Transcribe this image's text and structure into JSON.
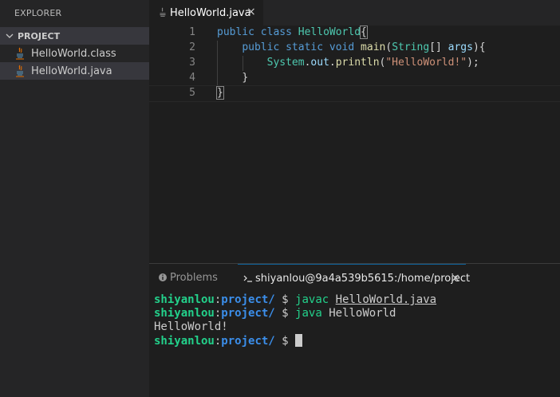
{
  "sidebar": {
    "title": "EXPLORER",
    "section": "PROJECT",
    "files": [
      {
        "name": "HelloWorld.class",
        "icon": "java-icon"
      },
      {
        "name": "HelloWorld.java",
        "icon": "java-icon"
      }
    ]
  },
  "editor": {
    "tab": {
      "label": "HelloWorld.java",
      "close": "×"
    },
    "line_numbers": [
      "1",
      "2",
      "3",
      "4",
      "5"
    ],
    "code": {
      "l1": {
        "kw1": "public",
        "kw2": "class",
        "name": "HelloWorld",
        "open": "{"
      },
      "l2": {
        "kw1": "public",
        "kw2": "static",
        "kw3": "void",
        "fn": "main",
        "p1": "(",
        "type": "String",
        "arr": "[]",
        "arg": "args",
        "p2": "){"
      },
      "l3": {
        "obj": "System",
        "dot1": ".",
        "field": "out",
        "dot2": ".",
        "fn": "println",
        "p1": "(",
        "str": "\"HelloWorld!\"",
        "p2": ");"
      },
      "l4": {
        "close": "}"
      },
      "l5": {
        "close": "}"
      }
    }
  },
  "panel": {
    "problems_label": "Problems",
    "terminal_label": "shiyanlou@9a4a539b5615:/home/project",
    "close": "×",
    "terminal": [
      {
        "user": "shiyanlou",
        "sep": ":",
        "path": "project/",
        "prompt": " $ ",
        "cmd": "javac",
        "arg": "HelloWorld.java"
      },
      {
        "user": "shiyanlou",
        "sep": ":",
        "path": "project/",
        "prompt": " $ ",
        "cmd": "java",
        "arg": "HelloWorld"
      },
      {
        "output": "HelloWorld!"
      },
      {
        "user": "shiyanlou",
        "sep": ":",
        "path": "project/",
        "prompt": " $ "
      }
    ]
  },
  "colors": {
    "background": "#1e1e1e",
    "sidebar": "#252526",
    "accent": "#0e639c",
    "java_icon": "#e76f00",
    "terminal_green": "#23d18b",
    "terminal_blue": "#3b8eea"
  }
}
